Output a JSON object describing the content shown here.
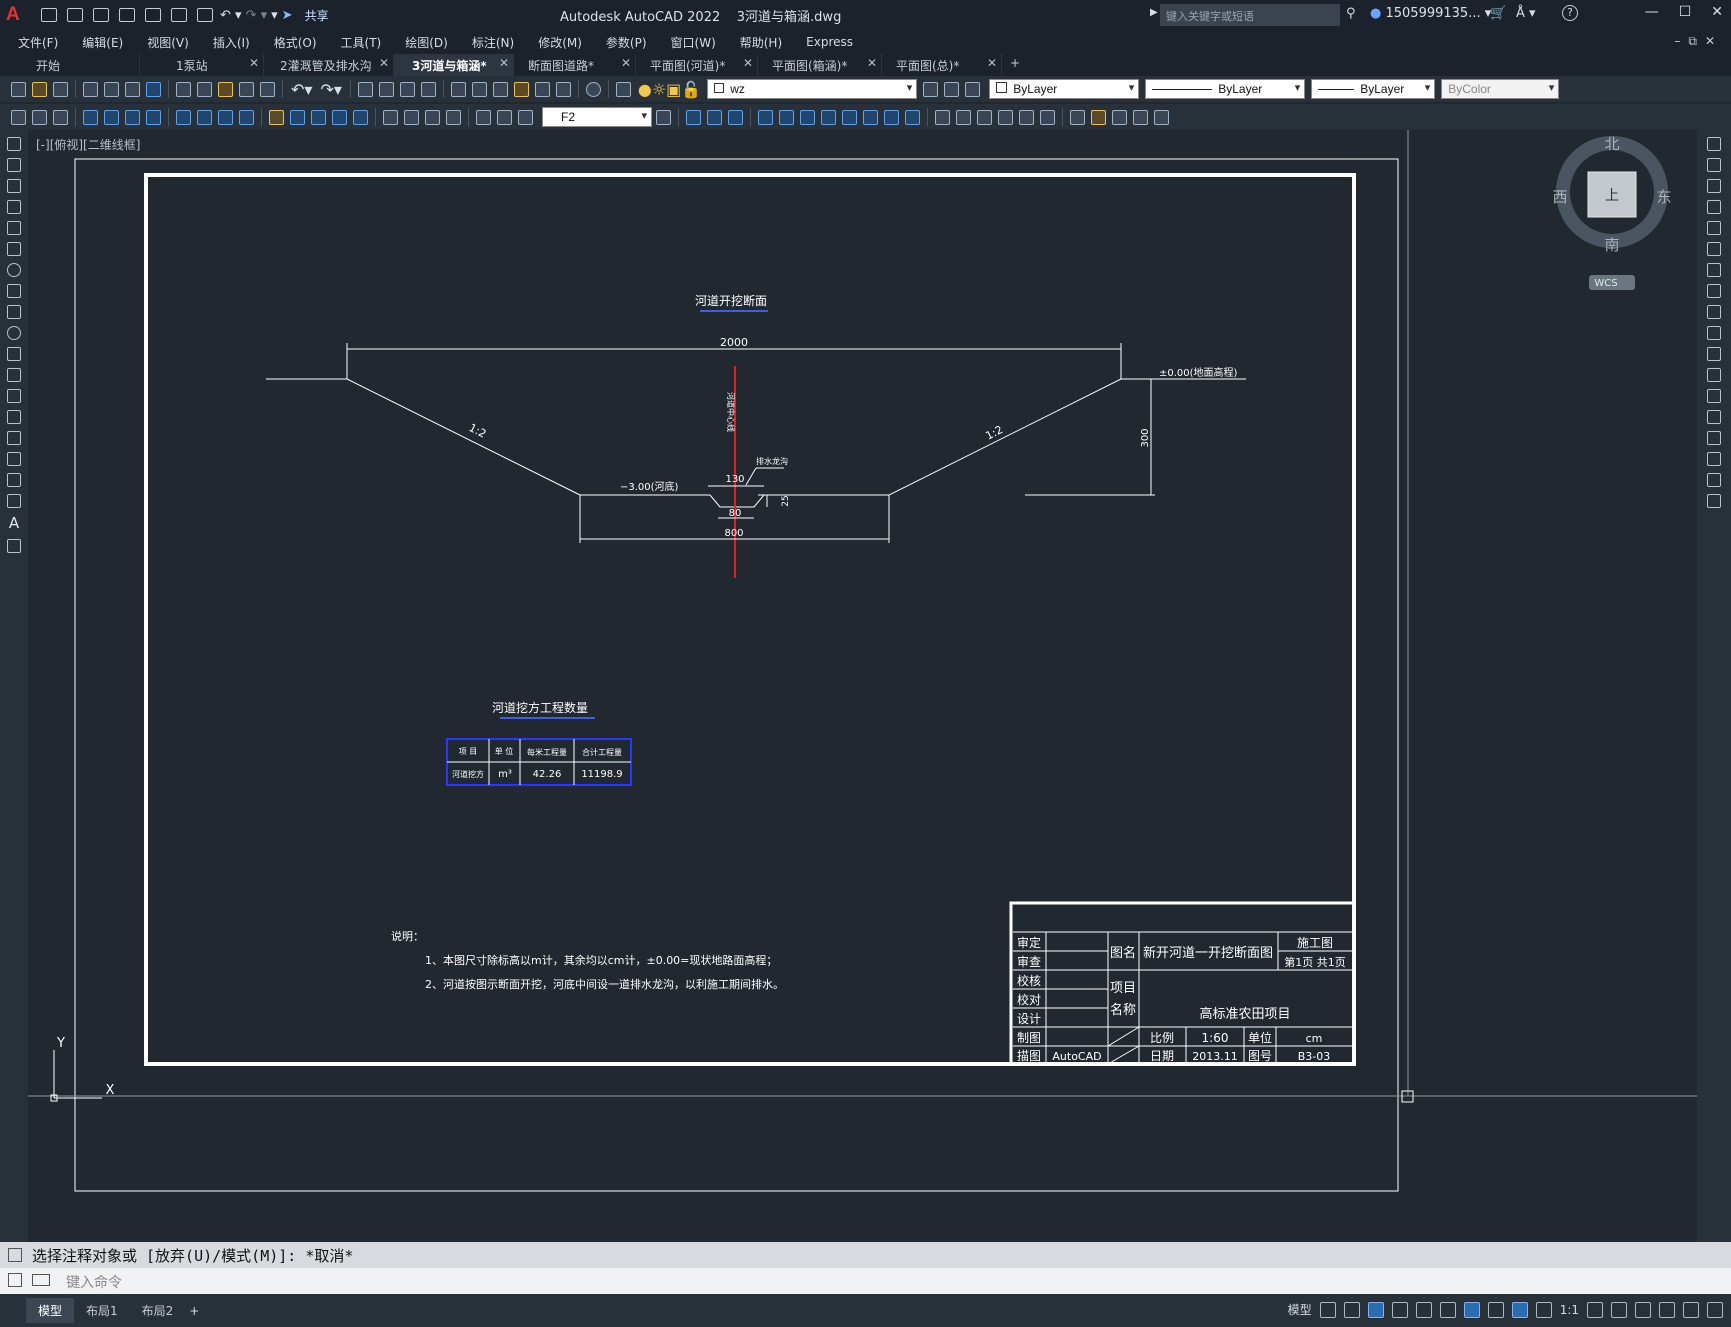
{
  "titlebar": {
    "title": "Autodesk AutoCAD 2022    3河道与箱涵.dwg",
    "share": "共享",
    "search_placeholder": "键入关键字或短语",
    "user": "1505999135...",
    "logo": "A"
  },
  "menu": [
    "文件(F)",
    "编辑(E)",
    "视图(V)",
    "插入(I)",
    "格式(O)",
    "工具(T)",
    "绘图(D)",
    "标注(N)",
    "修改(M)",
    "参数(P)",
    "窗口(W)",
    "帮助(H)",
    "Express"
  ],
  "tabs": [
    {
      "label": "开始",
      "close": false
    },
    {
      "label": "1泵站",
      "close": true
    },
    {
      "label": "2灌溉管及排水沟",
      "close": true
    },
    {
      "label": "3河道与箱涵*",
      "close": true,
      "active": true
    },
    {
      "label": "断面图道路*",
      "close": true
    },
    {
      "label": "平面图(河道)*",
      "close": true
    },
    {
      "label": "平面图(箱涵)*",
      "close": true
    },
    {
      "label": "平面图(总)*",
      "close": true
    }
  ],
  "toolbar": {
    "layer": "wz",
    "color": "ByLayer",
    "linetype": "ByLayer",
    "lineweight": "ByLayer",
    "plotstyle": "ByColor",
    "textstyle": "F2"
  },
  "viewport": {
    "label": "[-][俯视][二维线框]",
    "compass": {
      "north": "北",
      "south": "南",
      "east": "东",
      "west": "西",
      "face": "上",
      "wcs": "WCS"
    }
  },
  "drawing": {
    "section_title": "河道开挖断面",
    "dim_top": "2000",
    "slope_left": "1:2",
    "slope_right": "1:2",
    "ground_level": "±0.00(地面高程)",
    "dim_height": "300",
    "bottom_level": "−3.00(河底)",
    "centerline_label": "河道中心线",
    "drain_label": "排水龙沟",
    "dim_130": "130",
    "dim_25": "25",
    "dim_80": "80",
    "dim_800": "800",
    "qty_title": "河道挖方工程数量",
    "qty_table": {
      "headers": [
        "项  目",
        "单 位",
        "每米工程量",
        "合计工程量"
      ],
      "rows": [
        [
          "河道挖方",
          "m³",
          "42.26",
          "11198.9"
        ]
      ]
    },
    "notes_title": "说明：",
    "notes": [
      "1、本图尺寸除标高以m计，其余均以cm计，±0.00=现状地路面高程；",
      "2、河道按图示断面开挖，河底中间设一道排水龙沟，以利施工期间排水。"
    ],
    "title_block": {
      "left_labels": [
        "审定",
        "审查",
        "校核",
        "校对",
        "设计",
        "制图",
        "描图"
      ],
      "drawn_with": "AutoCAD",
      "name_label": "图名",
      "drawing_name": "新开河道一开挖断面图",
      "stage": "施工图",
      "page": "第1页  共1页",
      "project_label_1": "项目",
      "project_label_2": "名称",
      "project_name": "高标准农田项目",
      "scale_label": "比例",
      "scale": "1:60",
      "unit_label": "单位",
      "unit": "cm",
      "date_label": "日期",
      "date": "2013.11",
      "drawing_no_label": "图号",
      "drawing_no": "B3-03"
    },
    "ucs_y": "Y",
    "ucs_x": "X"
  },
  "command": {
    "history": "选择注释对象或 [放弃(U)/模式(M)]: *取消*",
    "input_placeholder": "键入命令"
  },
  "status": {
    "layouts": [
      "模型",
      "布局1",
      "布局2"
    ],
    "model_label": "模型",
    "scale": "1:1"
  }
}
